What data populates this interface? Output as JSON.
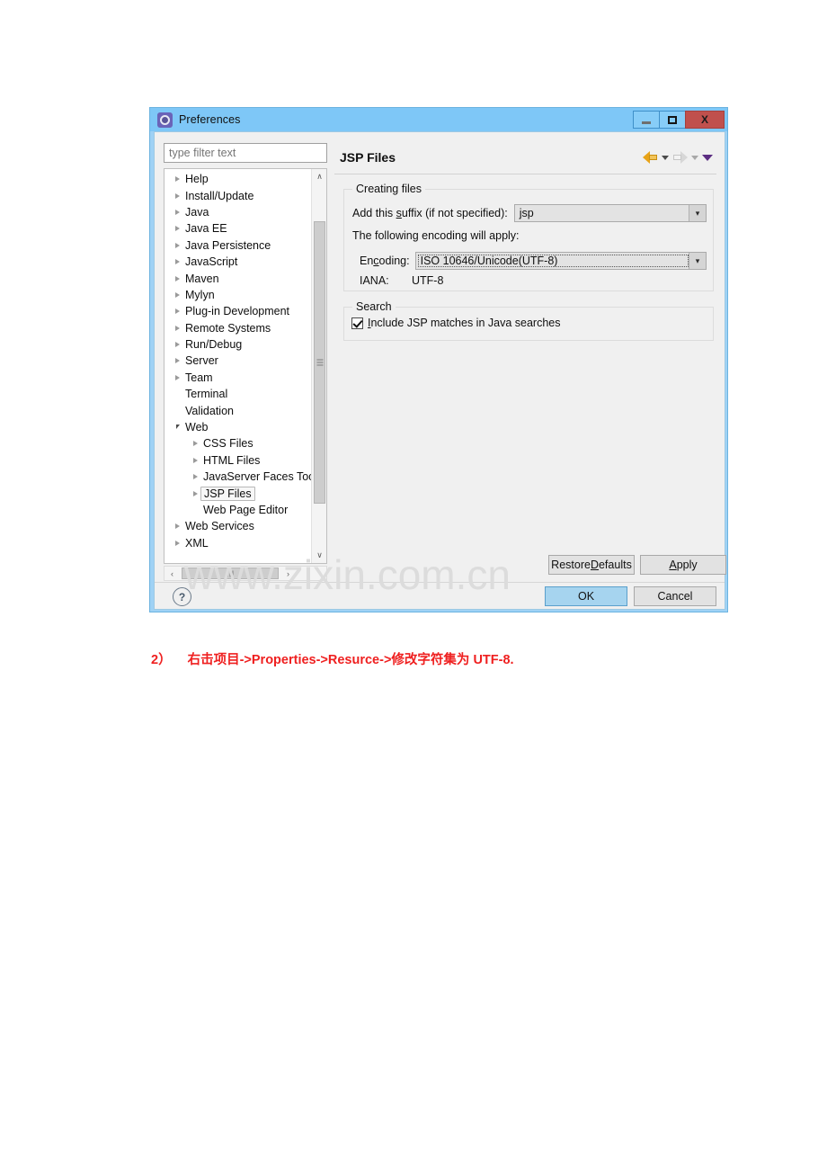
{
  "window": {
    "title": "Preferences",
    "icon": "preferences-gear-icon",
    "controls": {
      "minimize": "–",
      "maximize": "□",
      "close": "X"
    }
  },
  "tree": {
    "filter_placeholder": "type filter text",
    "filter_value": "",
    "items": [
      {
        "label": "Help",
        "indent": 0,
        "state": "collapsed"
      },
      {
        "label": "Install/Update",
        "indent": 0,
        "state": "collapsed"
      },
      {
        "label": "Java",
        "indent": 0,
        "state": "collapsed"
      },
      {
        "label": "Java EE",
        "indent": 0,
        "state": "collapsed"
      },
      {
        "label": "Java Persistence",
        "indent": 0,
        "state": "collapsed"
      },
      {
        "label": "JavaScript",
        "indent": 0,
        "state": "collapsed"
      },
      {
        "label": "Maven",
        "indent": 0,
        "state": "collapsed"
      },
      {
        "label": "Mylyn",
        "indent": 0,
        "state": "collapsed"
      },
      {
        "label": "Plug-in Development",
        "indent": 0,
        "state": "collapsed"
      },
      {
        "label": "Remote Systems",
        "indent": 0,
        "state": "collapsed"
      },
      {
        "label": "Run/Debug",
        "indent": 0,
        "state": "collapsed"
      },
      {
        "label": "Server",
        "indent": 0,
        "state": "collapsed"
      },
      {
        "label": "Team",
        "indent": 0,
        "state": "collapsed"
      },
      {
        "label": "Terminal",
        "indent": 0,
        "state": "leaf"
      },
      {
        "label": "Validation",
        "indent": 0,
        "state": "leaf"
      },
      {
        "label": "Web",
        "indent": 0,
        "state": "expanded"
      },
      {
        "label": "CSS Files",
        "indent": 1,
        "state": "collapsed"
      },
      {
        "label": "HTML Files",
        "indent": 1,
        "state": "collapsed"
      },
      {
        "label": "JavaServer Faces Too",
        "indent": 1,
        "state": "collapsed"
      },
      {
        "label": "JSP Files",
        "indent": 1,
        "state": "collapsed",
        "selected": true
      },
      {
        "label": "Web Page Editor",
        "indent": 1,
        "state": "leaf"
      },
      {
        "label": "Web Services",
        "indent": 0,
        "state": "collapsed"
      },
      {
        "label": "XML",
        "indent": 0,
        "state": "collapsed"
      }
    ],
    "vscroll": {
      "up": "∧",
      "down": "∨"
    },
    "hscroll": {
      "left": "‹",
      "right": "›"
    }
  },
  "page": {
    "title": "JSP Files",
    "nav": {
      "back_icon": "arrow-back-icon",
      "back_menu_icon": "chevron-down-icon",
      "forward_icon": "arrow-forward-icon",
      "forward_menu_icon": "chevron-down-icon",
      "view_menu_icon": "chevron-down-icon"
    },
    "creating_files": {
      "legend": "Creating files",
      "suffix_label_pre": "Add this ",
      "suffix_label_mnemonic": "s",
      "suffix_label_post": "uffix (if not specified):",
      "suffix_value": "jsp",
      "encoding_note": "The following encoding will apply:",
      "encoding_label_pre": "En",
      "encoding_label_mnemonic": "c",
      "encoding_label_post": "oding:",
      "encoding_value": "ISO 10646/Unicode(UTF-8)",
      "iana_label": "IANA:",
      "iana_value": "UTF-8",
      "dropdown_icon": "chevron-down-icon"
    },
    "search": {
      "legend": "Search",
      "checkbox_label_pre": "",
      "checkbox_label_mnemonic": "I",
      "checkbox_label_post": "nclude JSP matches in Java searches",
      "checked": true
    },
    "buttons": {
      "restore_pre": "Restore ",
      "restore_mnemonic": "D",
      "restore_post": "efaults",
      "apply_pre": "",
      "apply_mnemonic": "A",
      "apply_post": "pply",
      "ok": "OK",
      "cancel": "Cancel",
      "help_icon": "help-question-icon",
      "help_glyph": "?"
    }
  },
  "watermark": "www.zixin.com.cn",
  "caption": {
    "number": "2）",
    "text": "右击项目->Properties->Resurce->修改字符集为 UTF-8.",
    "color": "#ef2020"
  }
}
